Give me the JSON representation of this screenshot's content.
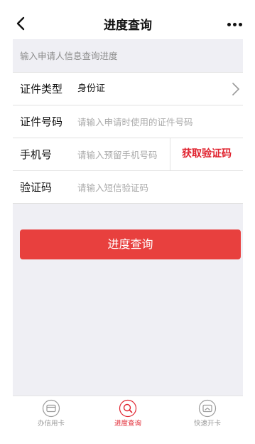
{
  "nav": {
    "title": "进度查询",
    "back_icon": "chevron-left-icon",
    "more_icon": "more-dots-icon"
  },
  "hint": "输入申请人信息查询进度",
  "form": {
    "id_type": {
      "label": "证件类型",
      "value": "身份证",
      "icon": "chevron-right-icon"
    },
    "id_number": {
      "label": "证件号码",
      "placeholder": "请输入申请时使用的证件号码"
    },
    "phone": {
      "label": "手机号",
      "placeholder": "请输入预留手机号码",
      "sms_button": "获取验证码"
    },
    "code": {
      "label": "验证码",
      "placeholder": "请输入短信验证码"
    }
  },
  "submit_label": "进度查询",
  "tabs": [
    {
      "label": "办信用卡",
      "icon": "card-icon",
      "active": false
    },
    {
      "label": "进度查询",
      "icon": "search-icon",
      "active": true
    },
    {
      "label": "快速开卡",
      "icon": "card-activate-icon",
      "active": false
    }
  ],
  "colors": {
    "accent": "#e0222e",
    "button": "#e8403e",
    "background": "#efeff4"
  }
}
